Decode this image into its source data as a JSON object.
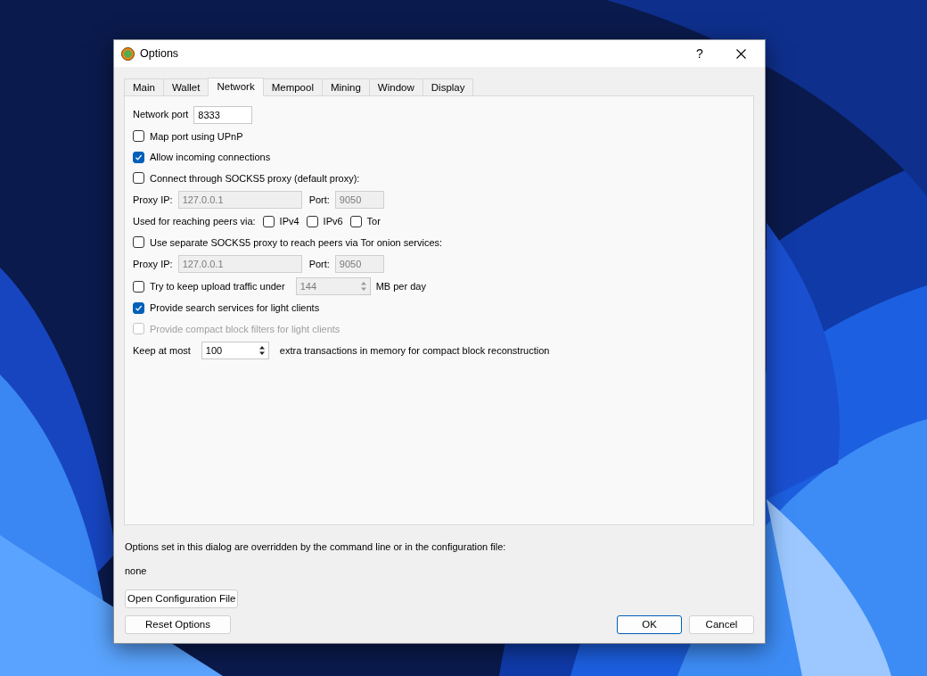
{
  "window": {
    "title": "Options",
    "help_button": "?"
  },
  "tabs": [
    {
      "label": "Main",
      "selected": false
    },
    {
      "label": "Wallet",
      "selected": false
    },
    {
      "label": "Network",
      "selected": true
    },
    {
      "label": "Mempool",
      "selected": false
    },
    {
      "label": "Mining",
      "selected": false
    },
    {
      "label": "Window",
      "selected": false
    },
    {
      "label": "Display",
      "selected": false
    }
  ],
  "network": [
    {
      "kind": "field",
      "label": "Network port",
      "value": "8333"
    },
    {
      "kind": "checkbox",
      "label": "Map port using UPnP",
      "checked": false,
      "disabled": false
    },
    {
      "kind": "checkbox",
      "label": "Allow incoming connections",
      "checked": true,
      "disabled": false
    },
    {
      "kind": "checkbox",
      "label": "Connect through SOCKS5 proxy (default proxy):",
      "checked": false,
      "disabled": false
    },
    {
      "kind": "proxy",
      "ip_label": "Proxy IP:",
      "ip": "127.0.0.1",
      "port_label": "Port:",
      "port": "9050",
      "disabled": true
    },
    {
      "kind": "reach",
      "label": "Used for reaching peers via:",
      "options": [
        {
          "label": "IPv4",
          "checked": false
        },
        {
          "label": "IPv6",
          "checked": false
        },
        {
          "label": "Tor",
          "checked": false
        }
      ]
    },
    {
      "kind": "checkbox",
      "label": "Use separate SOCKS5 proxy to reach peers via Tor onion services:",
      "checked": false,
      "disabled": false
    },
    {
      "kind": "proxy",
      "ip_label": "Proxy IP:",
      "ip": "127.0.0.1",
      "port_label": "Port:",
      "port": "9050",
      "disabled": true
    },
    {
      "kind": "limit",
      "label": "Try to keep upload traffic under",
      "checked": false,
      "value": "144",
      "unit": "MB per day",
      "disabled": true
    },
    {
      "kind": "checkbox",
      "label": "Provide search services for light clients",
      "checked": true,
      "disabled": false
    },
    {
      "kind": "checkbox",
      "label": "Provide compact block filters for light clients",
      "checked": false,
      "disabled": true
    },
    {
      "kind": "spin",
      "label": "Keep at most",
      "value": "100",
      "suffix": "extra transactions in memory for compact block reconstruction"
    }
  ],
  "notice": "Options set in this dialog are overridden by the command line or in the configuration file:",
  "notice_value": "none",
  "buttons": [
    {
      "label": "Open Configuration File",
      "kind": "left"
    },
    {
      "label": "Reset Options",
      "kind": "left"
    },
    {
      "label": "OK",
      "kind": "right",
      "default": true
    },
    {
      "label": "Cancel",
      "kind": "right",
      "default": false
    }
  ]
}
